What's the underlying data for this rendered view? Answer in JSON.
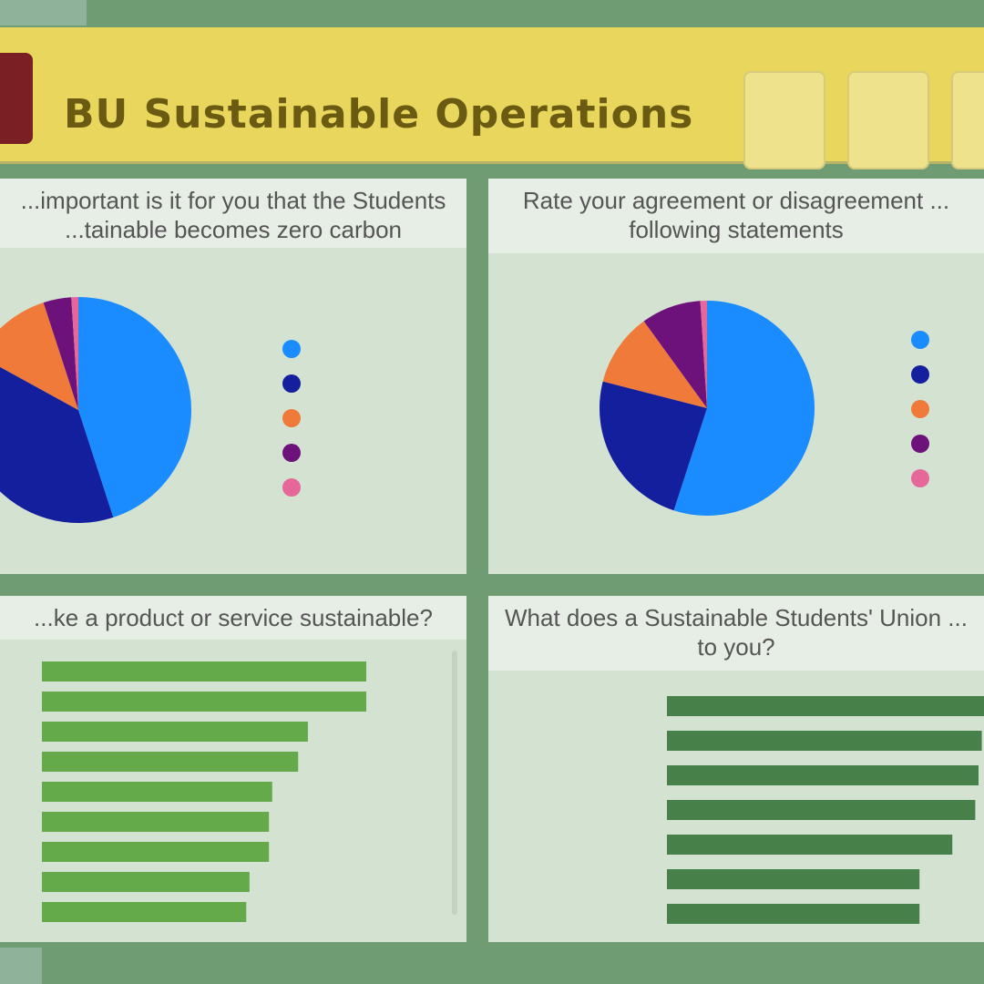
{
  "header": {
    "title": "BU Sustainable Operations",
    "kpis": [
      {
        "label": "",
        "value": ""
      },
      {
        "label": "",
        "value": ""
      },
      {
        "label": "",
        "value": ""
      }
    ]
  },
  "panels": {
    "top_left": {
      "title": "...important is it for you that the Students ...tainable becomes zero carbon organisation?",
      "callout": "",
      "legend": [
        "",
        "",
        "",
        "",
        ""
      ]
    },
    "top_right": {
      "title": "Rate your agreement or disagreement ... following statements",
      "callouts": [
        "",
        "",
        ""
      ],
      "legend": [
        "",
        "",
        "",
        "",
        ""
      ]
    },
    "bottom_left": {
      "title": "...ke a product or service sustainable?"
    },
    "bottom_right": {
      "title": "What does a Sustainable Students' Union ... to you?"
    }
  },
  "colors": {
    "pie": [
      "#1a8cff",
      "#141f9e",
      "#ef7a3a",
      "#6d127a",
      "#e6689a"
    ],
    "bar_light": "#64aa4a",
    "bar_dark": "#48804a"
  },
  "chart_data": [
    {
      "type": "pie",
      "title": "",
      "labels": [
        "",
        "",
        "",
        "",
        ""
      ],
      "values": [
        45,
        38,
        12,
        4,
        1
      ]
    },
    {
      "type": "pie",
      "title": "",
      "labels": [
        "",
        "",
        "",
        "",
        ""
      ],
      "values": [
        55,
        24,
        11,
        9,
        1
      ]
    },
    {
      "type": "bar",
      "orientation": "horizontal",
      "categories": [
        "",
        "",
        "",
        "",
        "",
        "",
        "",
        "",
        ""
      ],
      "values": [
        100,
        100,
        82,
        79,
        71,
        70,
        70,
        64,
        63
      ],
      "value_labels": [
        "",
        "",
        "",
        "",
        "",
        "",
        "",
        "",
        ""
      ]
    },
    {
      "type": "bar",
      "orientation": "horizontal",
      "categories": [
        "",
        "",
        "",
        "",
        "",
        "",
        ""
      ],
      "values": [
        100,
        96,
        95,
        94,
        87,
        77,
        77
      ],
      "value_labels": [
        "",
        "",
        "",
        "",
        "",
        "",
        ""
      ]
    }
  ]
}
